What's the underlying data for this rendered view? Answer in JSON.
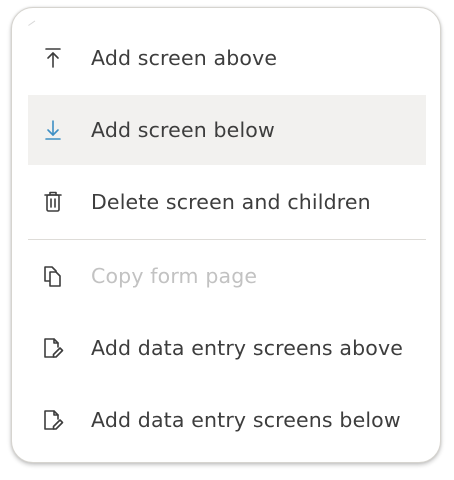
{
  "menu": {
    "items": [
      {
        "label": "Add screen above",
        "icon": "arrow-up-to-line-icon",
        "state": "normal"
      },
      {
        "label": "Add screen below",
        "icon": "arrow-down-to-line-icon",
        "state": "hover",
        "icon_color": "#3d8fc4"
      },
      {
        "label": "Delete screen and children",
        "icon": "trash-icon",
        "state": "normal"
      },
      {
        "label": "Copy form page",
        "icon": "copy-icon",
        "state": "disabled"
      },
      {
        "label": "Add data entry screens above",
        "icon": "file-edit-icon",
        "state": "normal"
      },
      {
        "label": "Add data entry screens below",
        "icon": "file-edit-icon",
        "state": "normal"
      }
    ]
  },
  "colors": {
    "text": "#3d3d3d",
    "disabled_text": "#c2c2c2",
    "hover_background": "#f2f1ef",
    "accent": "#3d8fc4",
    "border": "#d6d4cf"
  }
}
